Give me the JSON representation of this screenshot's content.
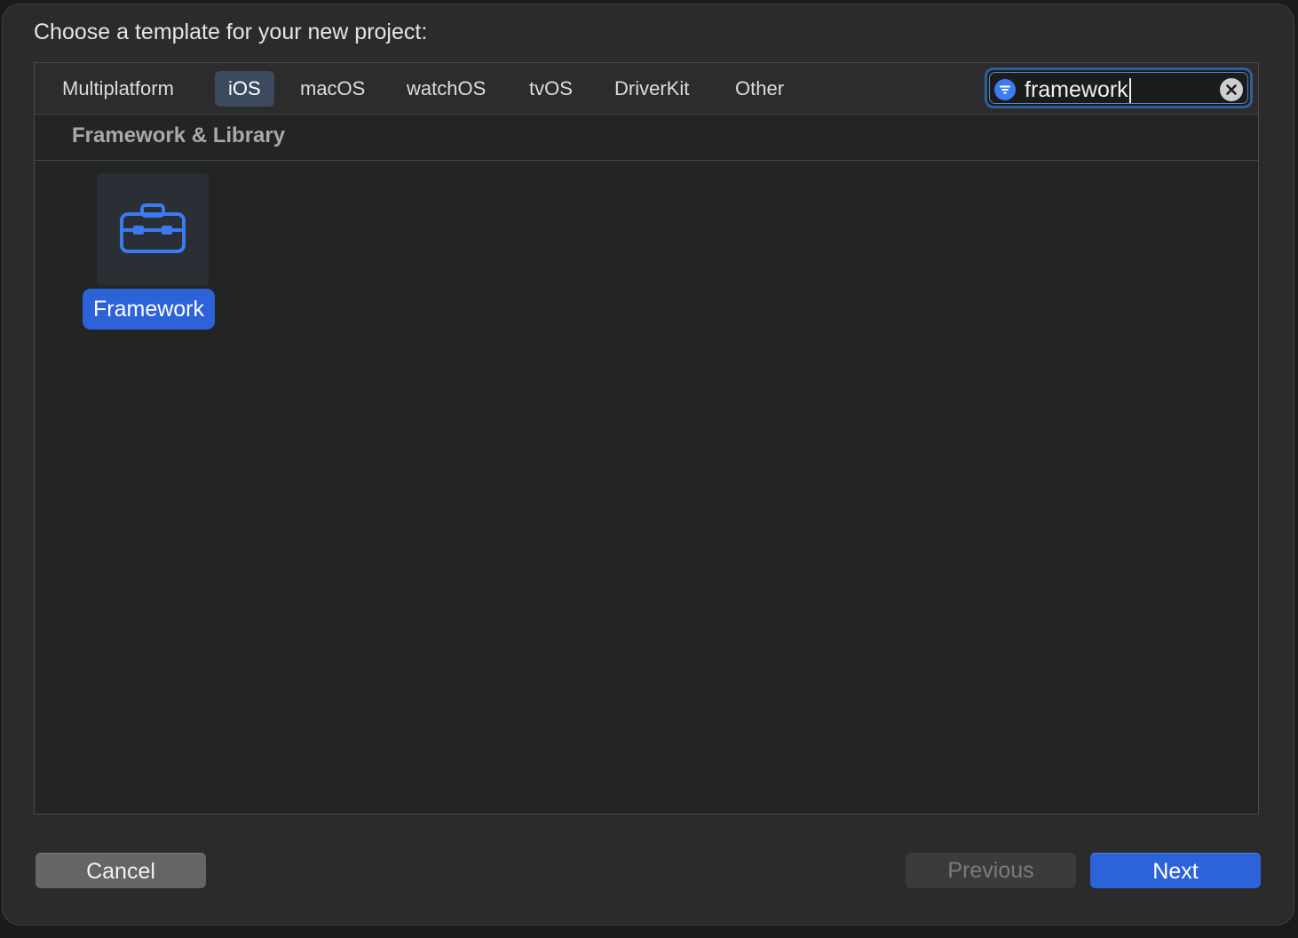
{
  "window": {
    "prompt": "Choose a template for your new project:"
  },
  "tabs": [
    {
      "label": "Multiplatform",
      "selected": false
    },
    {
      "label": "iOS",
      "selected": true
    },
    {
      "label": "macOS",
      "selected": false
    },
    {
      "label": "watchOS",
      "selected": false
    },
    {
      "label": "tvOS",
      "selected": false
    },
    {
      "label": "DriverKit",
      "selected": false
    },
    {
      "label": "Other",
      "selected": false
    }
  ],
  "search": {
    "value": "framework",
    "filter_icon": "filter-icon",
    "clear_icon": "clear-icon"
  },
  "section": {
    "title": "Framework & Library"
  },
  "templates": [
    {
      "label": "Framework",
      "icon": "toolbox-icon",
      "selected": true
    }
  ],
  "buttons": {
    "cancel": "Cancel",
    "previous": "Previous",
    "next": "Next"
  },
  "colors": {
    "accent": "#2d63d8",
    "background": "#2b2b2b",
    "panel": "#232424"
  }
}
